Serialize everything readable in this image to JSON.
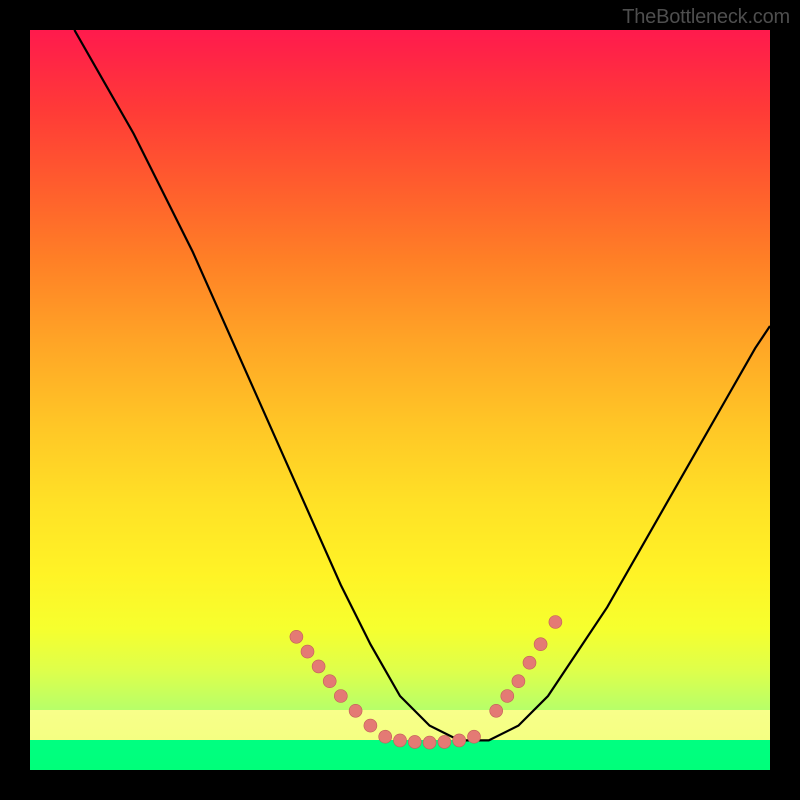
{
  "watermark": "TheBottleneck.com",
  "colors": {
    "frame": "#000000",
    "gradient_top": "#ff1a4d",
    "gradient_bottom": "#b7ff69",
    "yellow_strip": "#f6ff86",
    "green_strip": "#00ff7e",
    "curve": "#000000",
    "dot_fill": "#e47a74",
    "dot_stroke": "#c25f59"
  },
  "chart_data": {
    "type": "line",
    "title": "",
    "xlabel": "",
    "ylabel": "",
    "xlim": [
      0,
      100
    ],
    "ylim": [
      0,
      100
    ],
    "grid": false,
    "curve_description": "V-shaped bottleneck curve with minimum plateau around x 50–60; left branch starts near top-left, right branch rises to mid-right",
    "x": [
      6,
      10,
      14,
      18,
      22,
      26,
      30,
      34,
      38,
      42,
      46,
      50,
      54,
      58,
      62,
      66,
      70,
      74,
      78,
      82,
      86,
      90,
      94,
      98,
      100
    ],
    "y": [
      100,
      93,
      86,
      78,
      70,
      61,
      52,
      43,
      34,
      25,
      17,
      10,
      6,
      4,
      4,
      6,
      10,
      16,
      22,
      29,
      36,
      43,
      50,
      57,
      60
    ],
    "dots": {
      "left_cluster_x": [
        36,
        37.5,
        39,
        40.5,
        42,
        44,
        46
      ],
      "left_cluster_y": [
        18,
        16,
        14,
        12,
        10,
        8,
        6
      ],
      "bottom_cluster_x": [
        48,
        50,
        52,
        54,
        56,
        58,
        60
      ],
      "bottom_cluster_y": [
        4.5,
        4,
        3.8,
        3.7,
        3.8,
        4,
        4.5
      ],
      "right_cluster_x": [
        63,
        64.5,
        66,
        67.5,
        69,
        71
      ],
      "right_cluster_y": [
        8,
        10,
        12,
        14.5,
        17,
        20
      ]
    },
    "bands": [
      {
        "name": "severe-bottleneck-gradient",
        "y_range": [
          8,
          100
        ]
      },
      {
        "name": "near-optimal-yellow",
        "y_range": [
          4,
          8
        ]
      },
      {
        "name": "optimal-green",
        "y_range": [
          0,
          4
        ]
      }
    ]
  }
}
